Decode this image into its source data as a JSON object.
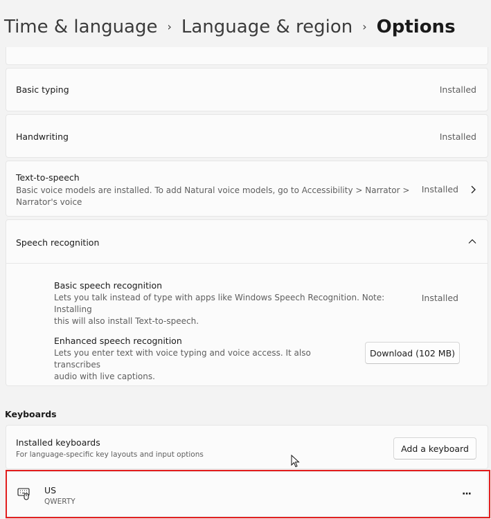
{
  "breadcrumb": {
    "items": [
      "Time & language",
      "Language & region",
      "Options"
    ],
    "separator": "›"
  },
  "options": {
    "basic_typing": {
      "title": "Basic typing",
      "status": "Installed"
    },
    "handwriting": {
      "title": "Handwriting",
      "status": "Installed"
    },
    "text_to_speech": {
      "title": "Text-to-speech",
      "description_line1": "Basic voice models are installed. To add Natural voice models, go to Accessibility > Narrator >",
      "description_line2": "Narrator's voice",
      "status": "Installed"
    },
    "speech_recognition": {
      "title": "Speech recognition",
      "expanded": true,
      "items": [
        {
          "title": "Basic speech recognition",
          "description_line1": "Lets you talk instead of type with apps like Windows Speech Recognition. Note: Installing",
          "description_line2": "this will also install Text-to-speech.",
          "status": "Installed"
        },
        {
          "title": "Enhanced speech recognition",
          "description_line1": "Lets you enter text with voice typing and voice access. It also transcribes",
          "description_line2": "audio with live captions.",
          "button_label": "Download (102 MB)"
        }
      ]
    }
  },
  "keyboards": {
    "section_label": "Keyboards",
    "installed": {
      "title": "Installed keyboards",
      "subtitle": "For language-specific key layouts and input options",
      "add_button_label": "Add a keyboard"
    },
    "list": [
      {
        "name": "US",
        "layout": "QWERTY",
        "icon": "keyboard-icon",
        "more_label": "···"
      }
    ]
  },
  "colors": {
    "highlight": "#e21d1d",
    "background": "#f3f3f3",
    "card": "#fbfbfb"
  }
}
